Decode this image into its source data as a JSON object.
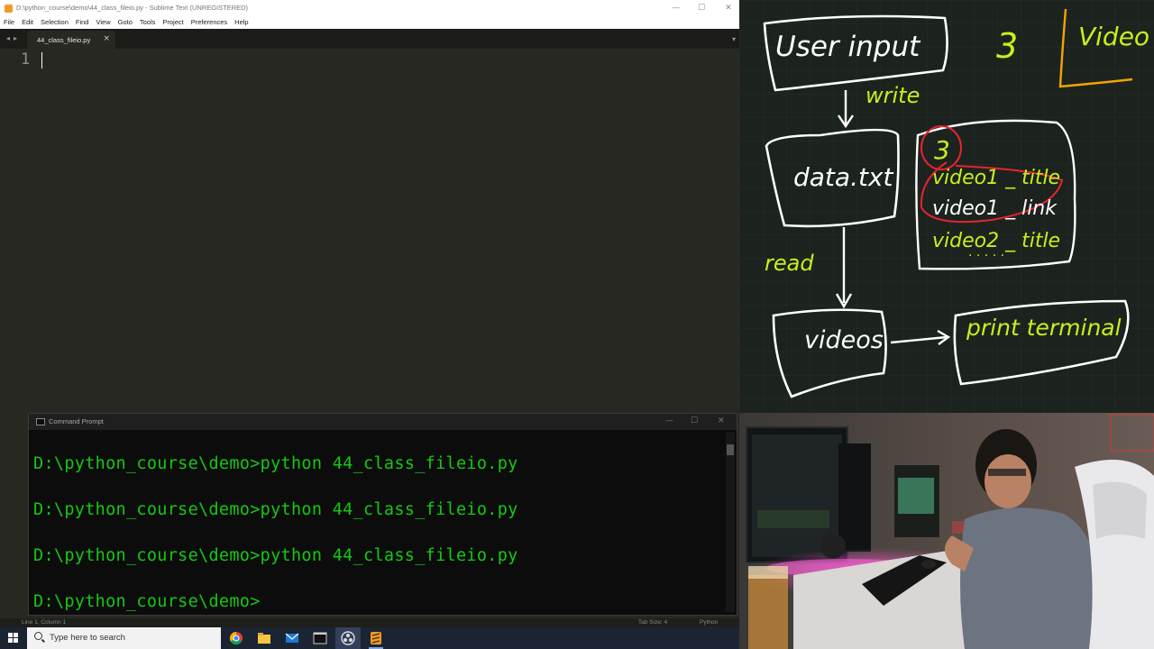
{
  "sublime": {
    "title": "D:\\python_course\\demo\\44_class_fileio.py - Sublime Text (UNREGISTERED)",
    "menu": [
      "File",
      "Edit",
      "Selection",
      "Find",
      "View",
      "Goto",
      "Tools",
      "Project",
      "Preferences",
      "Help"
    ],
    "tab": {
      "label": "44_class_fileio.py",
      "close": "×"
    },
    "nav_back": "◂",
    "nav_fwd": "▸",
    "tab_menu": "▾",
    "line_number": "1",
    "status": {
      "position": "Line 1, Column 1",
      "tab_size": "Tab Size: 4",
      "syntax": "Python"
    },
    "win_controls": {
      "minimize": "—",
      "maximize": "☐",
      "close": "✕"
    }
  },
  "cmd": {
    "title": "Command Prompt",
    "lines": [
      "D:\\python_course\\demo>python 44_class_fileio.py",
      "D:\\python_course\\demo>python 44_class_fileio.py",
      "D:\\python_course\\demo>python 44_class_fileio.py",
      "D:\\python_course\\demo>"
    ],
    "controls": {
      "minimize": "—",
      "maximize": "☐",
      "close": "✕"
    }
  },
  "taskbar": {
    "search_placeholder": "Type here to search",
    "apps": [
      "chrome-icon",
      "file-explorer-icon",
      "mail-icon",
      "terminal-icon",
      "obs-icon",
      "sublime-icon"
    ]
  },
  "whiteboard": {
    "user_input": "User   input",
    "number": "3",
    "video_corner": "Video",
    "write": "write",
    "data_file": "data.txt",
    "file_lines": [
      "3",
      "video1 _ title",
      "video1 _ link",
      "video2 _ title",
      "· · · · ·"
    ],
    "read": "read",
    "videos": "videos",
    "print_terminal": "print  terminal"
  },
  "colors": {
    "editor_bg": "#272822",
    "terminal_text": "#13c913",
    "board_bg": "#1c231e",
    "chalk_white": "#ffffff",
    "chalk_green": "#c6f01c",
    "chalk_red": "#e8232f",
    "chalk_orange": "#f5a300"
  }
}
